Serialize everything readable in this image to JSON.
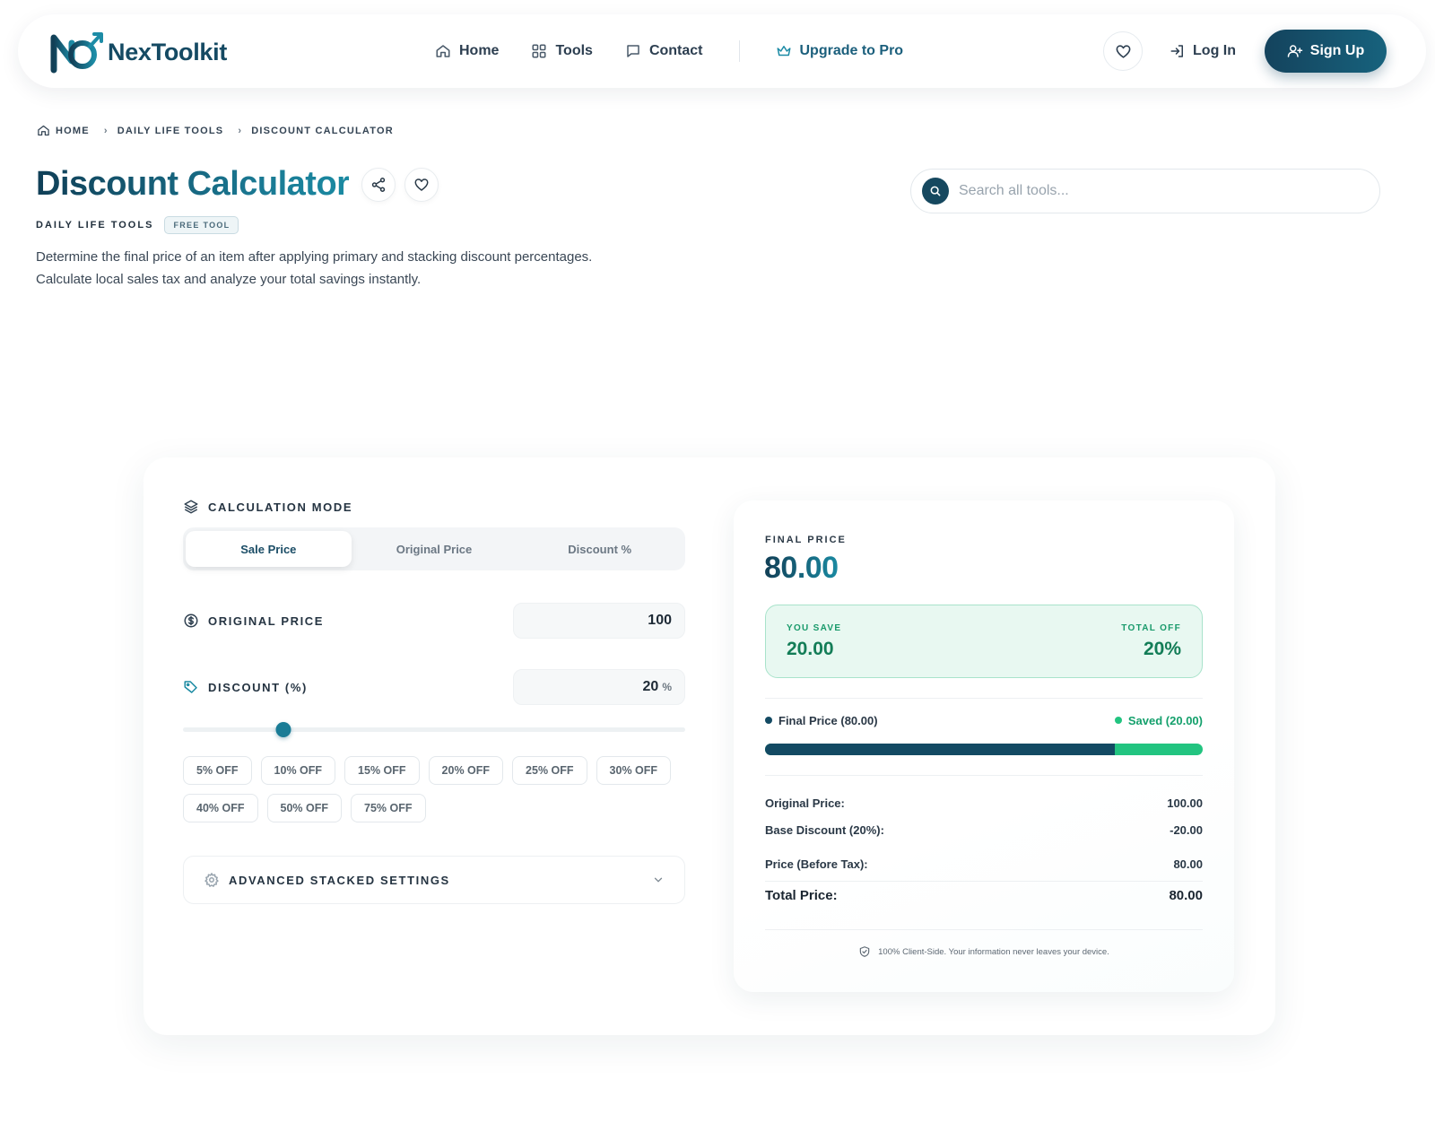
{
  "header": {
    "brand": "NexToolkit",
    "nav": [
      {
        "label": "Home",
        "icon": "home-icon"
      },
      {
        "label": "Tools",
        "icon": "grid-icon"
      },
      {
        "label": "Contact",
        "icon": "chat-icon"
      }
    ],
    "upgrade_label": "Upgrade to Pro",
    "login_label": "Log In",
    "signup_label": "Sign Up"
  },
  "breadcrumb": [
    "HOME",
    "DAILY LIFE TOOLS",
    "DISCOUNT CALCULATOR"
  ],
  "page": {
    "title": "Discount Calculator",
    "category": "DAILY LIFE TOOLS",
    "badge": "FREE TOOL",
    "description_line1": "Determine the final price of an item after applying primary and stacking discount percentages.",
    "description_line2": "Calculate local sales tax and analyze your total savings instantly."
  },
  "search": {
    "placeholder": "Search all tools..."
  },
  "calculator": {
    "mode_label": "CALCULATION MODE",
    "modes": [
      "Sale Price",
      "Original Price",
      "Discount %"
    ],
    "active_mode": 0,
    "original_price_label": "ORIGINAL PRICE",
    "original_price_value": "100",
    "discount_label": "DISCOUNT (%)",
    "discount_value": "20",
    "discount_unit": "%",
    "slider_fraction": 0.2,
    "presets": [
      "5% OFF",
      "10% OFF",
      "15% OFF",
      "20% OFF",
      "25% OFF",
      "30% OFF",
      "40% OFF",
      "50% OFF",
      "75% OFF"
    ],
    "advanced_label": "ADVANCED STACKED SETTINGS"
  },
  "result": {
    "final_label": "FINAL PRICE",
    "final_value": "80.00",
    "you_save_label": "YOU SAVE",
    "you_save_value": "20.00",
    "total_off_label": "TOTAL OFF",
    "total_off_value": "20%",
    "legend_final": "Final Price (80.00)",
    "legend_saved": "Saved (20.00)",
    "final_fraction": 0.8,
    "rows": [
      {
        "label": "Original Price:",
        "value": "100.00"
      },
      {
        "label": "Base Discount (20%):",
        "value": "-20.00"
      },
      {
        "label": "Price (Before Tax):",
        "value": "80.00"
      }
    ],
    "total_label": "Total Price:",
    "total_value": "80.00",
    "privacy_note": "100% Client-Side. Your information never leaves your device."
  },
  "colors": {
    "primary": "#14435d",
    "accent": "#1a8aa2",
    "savings": "#22c480"
  }
}
